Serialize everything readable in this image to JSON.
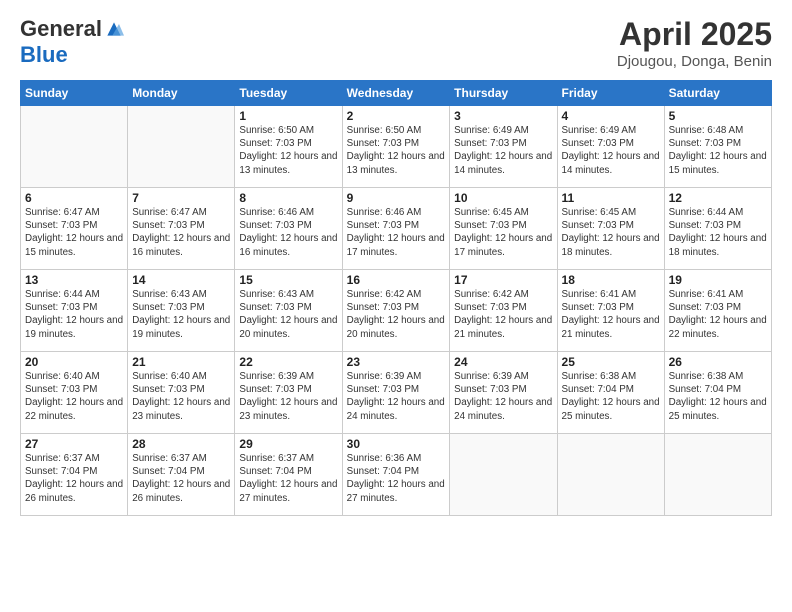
{
  "logo": {
    "general": "General",
    "blue": "Blue"
  },
  "title": "April 2025",
  "subtitle": "Djougou, Donga, Benin",
  "days": [
    "Sunday",
    "Monday",
    "Tuesday",
    "Wednesday",
    "Thursday",
    "Friday",
    "Saturday"
  ],
  "weeks": [
    [
      {
        "date": "",
        "info": ""
      },
      {
        "date": "",
        "info": ""
      },
      {
        "date": "1",
        "info": "Sunrise: 6:50 AM\nSunset: 7:03 PM\nDaylight: 12 hours and 13 minutes."
      },
      {
        "date": "2",
        "info": "Sunrise: 6:50 AM\nSunset: 7:03 PM\nDaylight: 12 hours and 13 minutes."
      },
      {
        "date": "3",
        "info": "Sunrise: 6:49 AM\nSunset: 7:03 PM\nDaylight: 12 hours and 14 minutes."
      },
      {
        "date": "4",
        "info": "Sunrise: 6:49 AM\nSunset: 7:03 PM\nDaylight: 12 hours and 14 minutes."
      },
      {
        "date": "5",
        "info": "Sunrise: 6:48 AM\nSunset: 7:03 PM\nDaylight: 12 hours and 15 minutes."
      }
    ],
    [
      {
        "date": "6",
        "info": "Sunrise: 6:47 AM\nSunset: 7:03 PM\nDaylight: 12 hours and 15 minutes."
      },
      {
        "date": "7",
        "info": "Sunrise: 6:47 AM\nSunset: 7:03 PM\nDaylight: 12 hours and 16 minutes."
      },
      {
        "date": "8",
        "info": "Sunrise: 6:46 AM\nSunset: 7:03 PM\nDaylight: 12 hours and 16 minutes."
      },
      {
        "date": "9",
        "info": "Sunrise: 6:46 AM\nSunset: 7:03 PM\nDaylight: 12 hours and 17 minutes."
      },
      {
        "date": "10",
        "info": "Sunrise: 6:45 AM\nSunset: 7:03 PM\nDaylight: 12 hours and 17 minutes."
      },
      {
        "date": "11",
        "info": "Sunrise: 6:45 AM\nSunset: 7:03 PM\nDaylight: 12 hours and 18 minutes."
      },
      {
        "date": "12",
        "info": "Sunrise: 6:44 AM\nSunset: 7:03 PM\nDaylight: 12 hours and 18 minutes."
      }
    ],
    [
      {
        "date": "13",
        "info": "Sunrise: 6:44 AM\nSunset: 7:03 PM\nDaylight: 12 hours and 19 minutes."
      },
      {
        "date": "14",
        "info": "Sunrise: 6:43 AM\nSunset: 7:03 PM\nDaylight: 12 hours and 19 minutes."
      },
      {
        "date": "15",
        "info": "Sunrise: 6:43 AM\nSunset: 7:03 PM\nDaylight: 12 hours and 20 minutes."
      },
      {
        "date": "16",
        "info": "Sunrise: 6:42 AM\nSunset: 7:03 PM\nDaylight: 12 hours and 20 minutes."
      },
      {
        "date": "17",
        "info": "Sunrise: 6:42 AM\nSunset: 7:03 PM\nDaylight: 12 hours and 21 minutes."
      },
      {
        "date": "18",
        "info": "Sunrise: 6:41 AM\nSunset: 7:03 PM\nDaylight: 12 hours and 21 minutes."
      },
      {
        "date": "19",
        "info": "Sunrise: 6:41 AM\nSunset: 7:03 PM\nDaylight: 12 hours and 22 minutes."
      }
    ],
    [
      {
        "date": "20",
        "info": "Sunrise: 6:40 AM\nSunset: 7:03 PM\nDaylight: 12 hours and 22 minutes."
      },
      {
        "date": "21",
        "info": "Sunrise: 6:40 AM\nSunset: 7:03 PM\nDaylight: 12 hours and 23 minutes."
      },
      {
        "date": "22",
        "info": "Sunrise: 6:39 AM\nSunset: 7:03 PM\nDaylight: 12 hours and 23 minutes."
      },
      {
        "date": "23",
        "info": "Sunrise: 6:39 AM\nSunset: 7:03 PM\nDaylight: 12 hours and 24 minutes."
      },
      {
        "date": "24",
        "info": "Sunrise: 6:39 AM\nSunset: 7:03 PM\nDaylight: 12 hours and 24 minutes."
      },
      {
        "date": "25",
        "info": "Sunrise: 6:38 AM\nSunset: 7:04 PM\nDaylight: 12 hours and 25 minutes."
      },
      {
        "date": "26",
        "info": "Sunrise: 6:38 AM\nSunset: 7:04 PM\nDaylight: 12 hours and 25 minutes."
      }
    ],
    [
      {
        "date": "27",
        "info": "Sunrise: 6:37 AM\nSunset: 7:04 PM\nDaylight: 12 hours and 26 minutes."
      },
      {
        "date": "28",
        "info": "Sunrise: 6:37 AM\nSunset: 7:04 PM\nDaylight: 12 hours and 26 minutes."
      },
      {
        "date": "29",
        "info": "Sunrise: 6:37 AM\nSunset: 7:04 PM\nDaylight: 12 hours and 27 minutes."
      },
      {
        "date": "30",
        "info": "Sunrise: 6:36 AM\nSunset: 7:04 PM\nDaylight: 12 hours and 27 minutes."
      },
      {
        "date": "",
        "info": ""
      },
      {
        "date": "",
        "info": ""
      },
      {
        "date": "",
        "info": ""
      }
    ]
  ]
}
